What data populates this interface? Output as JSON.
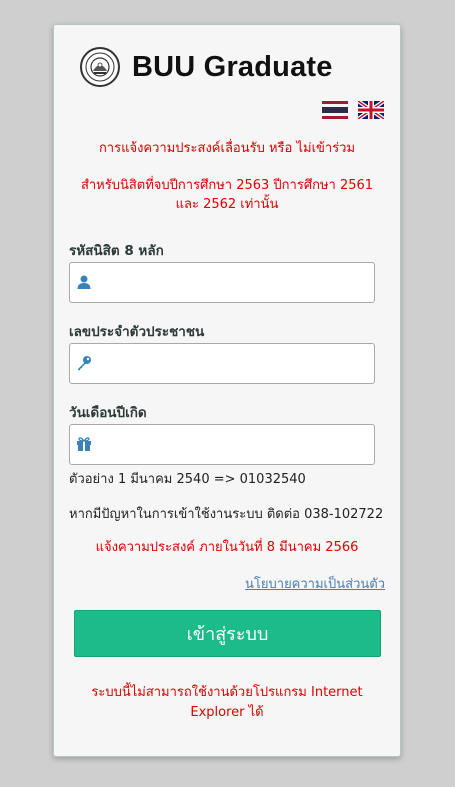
{
  "header": {
    "brand": "BUU Graduate"
  },
  "languages": [
    {
      "code": "th",
      "icon": "thai-flag-icon"
    },
    {
      "code": "en",
      "icon": "uk-flag-icon"
    }
  ],
  "notices": {
    "title": "การแจ้งความประสงค์เลื่อนรับ หรือ ไม่เข้าร่วม",
    "scope_line1": "สำหรับนิสิตที่จบปีการศึกษา 2563 ปีการศึกษา 2561",
    "scope_line2": "และ 2562 เท่านั้น"
  },
  "form": {
    "student_id": {
      "label": "รหัสนิสิต 8 หลัก",
      "value": "",
      "icon": "user-icon"
    },
    "national_id": {
      "label": "เลขประจำตัวประชาชน",
      "value": "",
      "icon": "key-icon"
    },
    "birthdate": {
      "label": "วันเดือนปีเกิด",
      "value": "",
      "icon": "gift-icon"
    },
    "birthdate_example": "ตัวอย่าง 1 มีนาคม 2540 => 01032540"
  },
  "contact": "หากมีปัญหาในการเข้าใช้งานระบบ ติดต่อ 038-102722",
  "deadline": "แจ้งความประสงค์ ภายในวันที่ 8 มีนาคม 2566",
  "privacy_link": "นโยบายความเป็นส่วนตัว",
  "login_button": "เข้าสู่ระบบ",
  "ie_warning_line1": "ระบบนี้ไม่สามารถใช้งานด้วยโปรแกรม Internet",
  "ie_warning_line2": "Explorer ได้",
  "colors": {
    "accent": "#1dbb8a",
    "warning_text": "#e00000",
    "link": "#4a7fb0",
    "icon": "#3b82b8"
  }
}
